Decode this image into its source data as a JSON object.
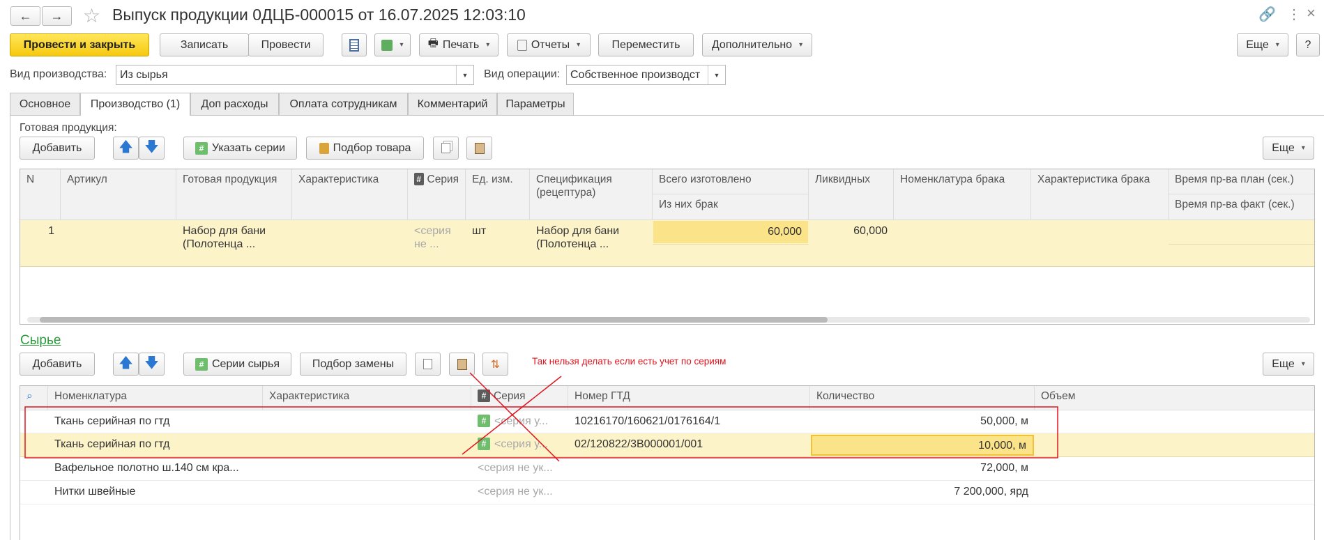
{
  "window": {
    "title": "Выпуск продукции 0ДЦБ-000015 от 16.07.2025 12:03:10",
    "back_icon": "←",
    "forward_icon": "→",
    "link_icon": "🔗",
    "more_icon": "⋮",
    "close_icon": "×"
  },
  "toolbar": {
    "post_close": "Провести и закрыть",
    "save": "Записать",
    "post": "Провести",
    "print": "Печать",
    "reports": "Отчеты",
    "move": "Переместить",
    "additional": "Дополнительно",
    "more": "Еще",
    "help": "?"
  },
  "form": {
    "production_type_label": "Вид производства:",
    "production_type_value": "Из сырья",
    "operation_type_label": "Вид операции:",
    "operation_type_value": "Собственное производст"
  },
  "tabs": [
    "Основное",
    "Производство (1)",
    "Доп расходы",
    "Оплата сотрудникам",
    "Комментарий",
    "Параметры"
  ],
  "products": {
    "section_label": "Готовая продукция:",
    "add": "Добавить",
    "specify_series": "Указать серии",
    "pick_goods": "Подбор товара",
    "more": "Еще",
    "columns": {
      "n": "N",
      "article": "Артикул",
      "product": "Готовая продукция",
      "characteristic": "Характеристика",
      "series": "Серия",
      "unit": "Ед. изм.",
      "spec": "Спецификация (рецептура)",
      "total": "Всего изготовлено",
      "defect": "Из них брак",
      "liquid": "Ликвидных",
      "defect_item": "Номенклатура брака",
      "defect_char": "Характеристика брака",
      "time_plan": "Время пр-ва план (сек.)",
      "time_fact": "Время пр-ва факт (сек.)"
    },
    "rows": [
      {
        "n": "1",
        "article": "",
        "product": "Набор для бани (Полотенца ...",
        "characteristic": "",
        "series": "<серия не ...",
        "unit": "шт",
        "spec": "Набор для бани (Полотенца ...",
        "total": "60,000",
        "liquid": "60,000"
      }
    ]
  },
  "raw": {
    "section_label": "Сырье",
    "add": "Добавить",
    "raw_series": "Серии сырья",
    "pick_replace": "Подбор замены",
    "more": "Еще",
    "annotation": "Так нельзя делать если есть учет по сериям",
    "columns": {
      "item": "Номенклатура",
      "characteristic": "Характеристика",
      "series": "Серия",
      "gtd": "Номер ГТД",
      "quantity": "Количество",
      "volume": "Объем"
    },
    "rows": [
      {
        "item": "Ткань серийная по гтд",
        "series": "<серия у...",
        "gtd": "10216170/160621/0176164/1",
        "quantity": "50,000, м"
      },
      {
        "item": "Ткань серийная по гтд",
        "series": "<серия у...",
        "gtd": "02/120822/3В000001/001",
        "quantity": "10,000, м"
      },
      {
        "item": "Вафельное полотно ш.140 см кра...",
        "series": "<серия не ук...",
        "gtd": "",
        "quantity": "72,000, м"
      },
      {
        "item": "Нитки швейные",
        "series": "<серия не ук...",
        "gtd": "",
        "quantity": "7 200,000, ярд"
      }
    ]
  },
  "colors": {
    "primary_button": "#f6c90e",
    "selected_row": "#fdf3c9",
    "highlight_cell": "#fbe38a",
    "annotation_red": "#e0141e",
    "link_green": "#2c9a3c"
  }
}
